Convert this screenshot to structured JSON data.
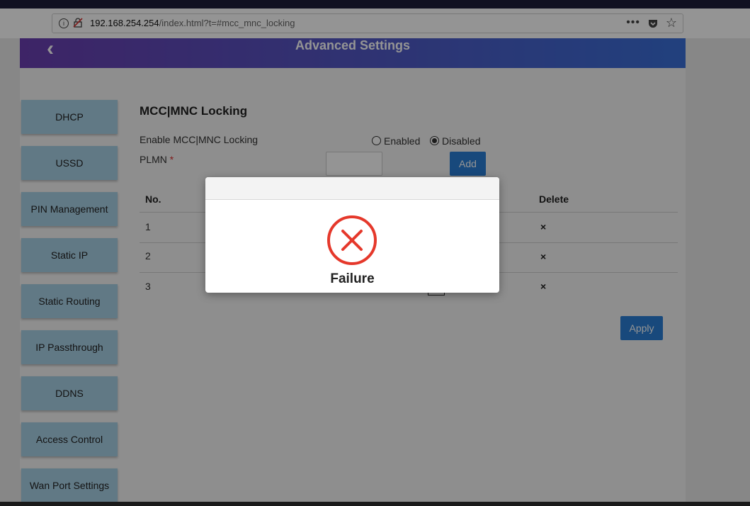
{
  "browser": {
    "url_host": "192.168.254.254",
    "url_path": "/index.html?t=#mcc_mnc_locking",
    "menu_dots": "•••",
    "info_glyph": "i",
    "star_glyph": "☆"
  },
  "header": {
    "title": "Advanced Settings",
    "back_glyph": "‹"
  },
  "sidebar": {
    "items": [
      {
        "label": "DHCP"
      },
      {
        "label": "USSD"
      },
      {
        "label": "PIN Management"
      },
      {
        "label": "Static IP"
      },
      {
        "label": "Static Routing"
      },
      {
        "label": "IP Passthrough"
      },
      {
        "label": "DDNS"
      },
      {
        "label": "Access Control"
      },
      {
        "label": "Wan Port Settings"
      }
    ]
  },
  "main": {
    "section_title": "MCC|MNC Locking",
    "enable_label": "Enable MCC|MNC Locking",
    "enabled_label": "Enabled",
    "disabled_label": "Disabled",
    "selected": "Disabled",
    "plmn_label": "PLMN",
    "required_mark": "*",
    "plmn_value": "",
    "add_button": "Add",
    "table": {
      "headers": {
        "no": "No.",
        "delete": "Delete"
      },
      "rows": [
        {
          "no": "1",
          "delete": "×"
        },
        {
          "no": "2",
          "delete": "×"
        },
        {
          "no": "3",
          "delete": "×"
        }
      ]
    },
    "apply_button": "Apply"
  },
  "modal": {
    "status_text": "Failure",
    "icon": "failure-x-icon"
  },
  "colors": {
    "accent": "#2a7fd6",
    "sidebar": "#a8d0e6",
    "failure": "#e5382b",
    "header_start": "#6b3fb1",
    "header_end": "#3a6fd8"
  }
}
